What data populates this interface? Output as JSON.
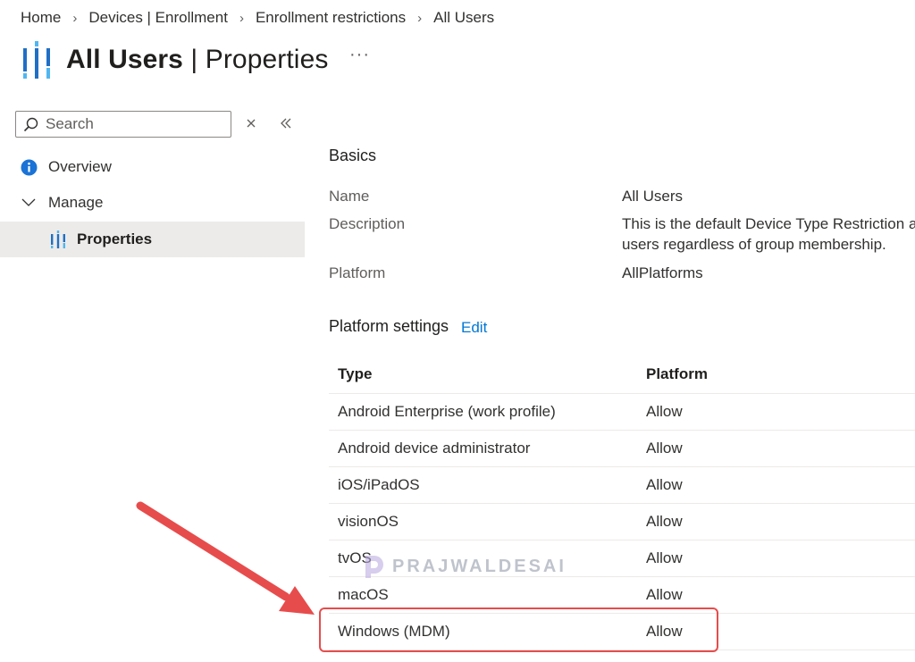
{
  "breadcrumb": [
    "Home",
    "Devices | Enrollment",
    "Enrollment restrictions",
    "All Users"
  ],
  "header": {
    "title_bold": "All Users",
    "title_rest": " | Properties",
    "more_label": "···"
  },
  "sidebar": {
    "search_placeholder": "Search",
    "items": [
      {
        "label": "Overview",
        "icon": "info-icon"
      },
      {
        "label": "Manage",
        "icon": "chevron-down-icon"
      },
      {
        "label": "Properties",
        "icon": "properties-icon",
        "selected": true
      }
    ]
  },
  "basics": {
    "title": "Basics",
    "fields": [
      {
        "label": "Name",
        "value": "All Users"
      },
      {
        "label": "Description",
        "value_line1": "This is the default Device Type Restriction ap",
        "value_line2": "users regardless of group membership."
      },
      {
        "label": "Platform",
        "value": "AllPlatforms"
      }
    ]
  },
  "platform_settings": {
    "title": "Platform settings",
    "edit_label": "Edit",
    "columns": [
      "Type",
      "Platform"
    ],
    "rows": [
      [
        "Android Enterprise (work profile)",
        "Allow"
      ],
      [
        "Android device administrator",
        "Allow"
      ],
      [
        "iOS/iPadOS",
        "Allow"
      ],
      [
        "visionOS",
        "Allow"
      ],
      [
        "tvOS",
        "Allow"
      ],
      [
        "macOS",
        "Allow"
      ],
      [
        "Windows (MDM)",
        "Allow"
      ]
    ]
  },
  "watermark": "PRAJWALDESAI",
  "colors": {
    "accent": "#0078d4",
    "annotation": "#e74c4c",
    "selected_bg": "#edebe9"
  }
}
